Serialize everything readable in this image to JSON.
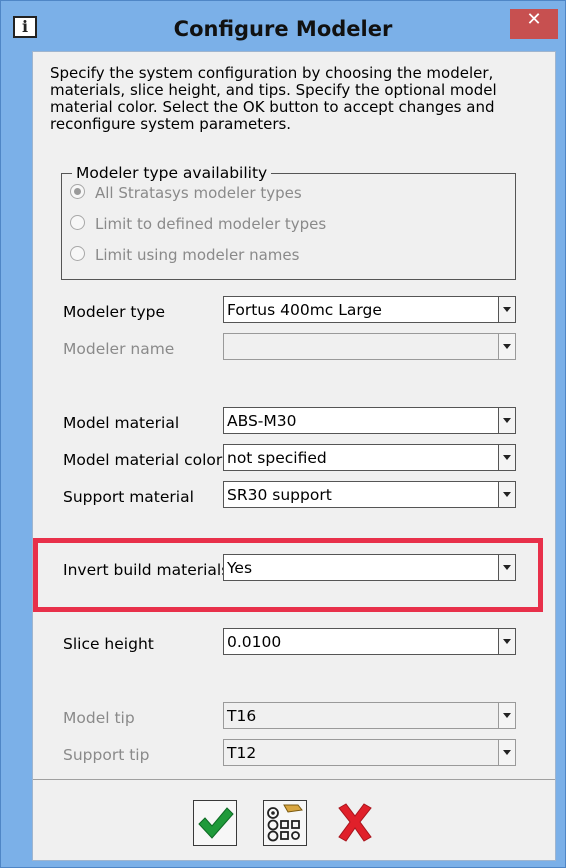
{
  "window": {
    "title": "Configure Modeler",
    "info_icon": "info-icon",
    "close_symbol": "✕"
  },
  "description": "Specify the system configuration by choosing the modeler, materials, slice height, and tips. Specify the optional model material color. Select the OK button to accept changes and reconfigure system parameters.",
  "availability": {
    "legend": "Modeler type availability",
    "options": [
      {
        "label": "All Stratasys modeler types",
        "selected": true
      },
      {
        "label": "Limit to defined modeler types",
        "selected": false
      },
      {
        "label": "Limit using modeler names",
        "selected": false
      }
    ]
  },
  "fields": {
    "modeler_type": {
      "label": "Modeler type",
      "value": "Fortus 400mc Large"
    },
    "modeler_name": {
      "label": "Modeler name",
      "value": ""
    },
    "model_material": {
      "label": "Model material",
      "value": "ABS-M30"
    },
    "model_material_color": {
      "label": "Model material color",
      "value": "not specified"
    },
    "support_material": {
      "label": "Support material",
      "value": "SR30 support"
    },
    "invert_build_materials": {
      "label": "Invert build materials",
      "value": "Yes"
    },
    "slice_height": {
      "label": "Slice height",
      "value": "0.0100"
    },
    "model_tip": {
      "label": "Model tip",
      "value": "T16"
    },
    "support_tip": {
      "label": "Support tip",
      "value": "T12"
    }
  },
  "buttons": {
    "ok": "checkmark-icon",
    "configure": "configure-icon",
    "cancel": "cancel-x-icon"
  },
  "colors": {
    "title_bar": "#7bb0e8",
    "close_button": "#c75050",
    "highlight": "#e8304a",
    "ok_green": "#1f9a3a",
    "cancel_red": "#e0202a"
  }
}
